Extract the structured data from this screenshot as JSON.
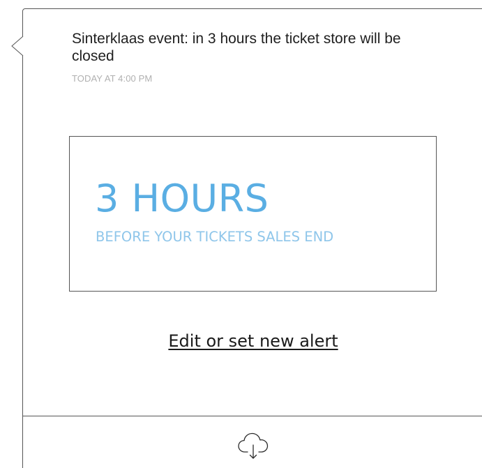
{
  "notification": {
    "title": "Sinterklaas event: in 3 hours the ticket store will be closed",
    "timestamp": "TODAY AT 4:00 PM"
  },
  "alert": {
    "headline": "3 HOURS",
    "subline": "BEFORE YOUR TICKETS SALES END"
  },
  "actions": {
    "edit_link": "Edit or set new alert",
    "download_icon": "cloud-download-icon"
  },
  "colors": {
    "accent": "#5aaee3",
    "accent_light": "#8fc6ea",
    "text": "#1f1f1f",
    "muted": "#b0b0b0",
    "border": "#555555"
  }
}
